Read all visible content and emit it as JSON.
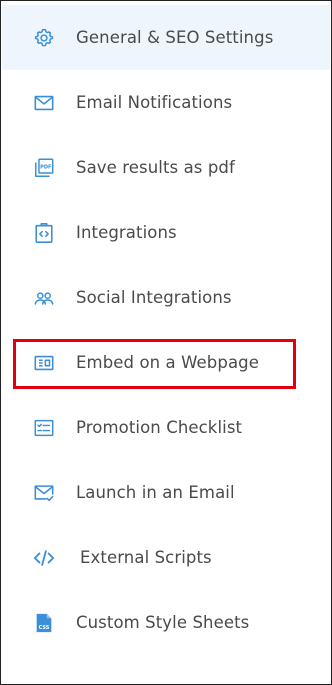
{
  "menu": {
    "items": [
      {
        "label": "General & SEO Settings",
        "icon": "gear-icon"
      },
      {
        "label": "Email Notifications",
        "icon": "envelope-icon"
      },
      {
        "label": "Save results as pdf",
        "icon": "pdf-icon"
      },
      {
        "label": "Integrations",
        "icon": "clipboard-code-icon"
      },
      {
        "label": "Social Integrations",
        "icon": "users-icon"
      },
      {
        "label": "Embed on a Webpage",
        "icon": "embed-icon"
      },
      {
        "label": "Promotion Checklist",
        "icon": "checklist-icon"
      },
      {
        "label": "Launch in an Email",
        "icon": "envelope-check-icon"
      },
      {
        "label": "External Scripts",
        "icon": "code-icon"
      },
      {
        "label": "Custom Style Sheets",
        "icon": "css-file-icon"
      }
    ],
    "active_index": 0,
    "highlighted_index": 5
  },
  "colors": {
    "icon_blue": "#3a8fd6",
    "label_text": "#4a4a4a",
    "active_background": "#eef5fd",
    "highlight_border": "#e0000f"
  }
}
